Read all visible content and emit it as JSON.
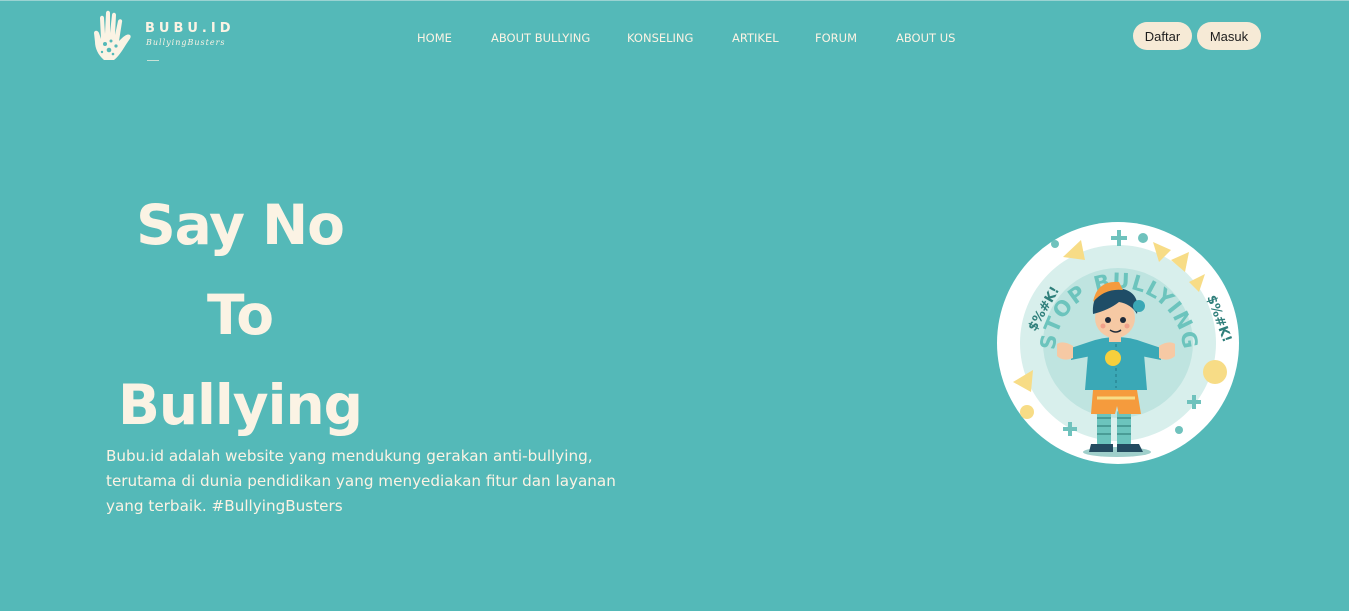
{
  "brand": {
    "name": "BUBU.ID",
    "tagline": "BullyingBusters"
  },
  "nav": {
    "items": [
      {
        "label": "HOME"
      },
      {
        "label": "ABOUT BULLYING"
      },
      {
        "label": "KONSELING"
      },
      {
        "label": "ARTIKEL"
      },
      {
        "label": "FORUM"
      },
      {
        "label": "ABOUT US"
      }
    ]
  },
  "auth": {
    "register_label": "Daftar",
    "login_label": "Masuk"
  },
  "hero": {
    "title_lines": [
      "Say No",
      "To",
      "Bullying"
    ],
    "description": "Bubu.id adalah website yang mendukung gerakan anti-bullying, terutama di dunia pendidikan yang menyediakan fitur dan layanan yang terbaik. #BullyingBusters"
  },
  "illustration": {
    "badge_text": "STOP BULLYING",
    "side_text": "$%#K!"
  },
  "colors": {
    "background": "#54b9b8",
    "cream": "#fbf3e4",
    "button_bg": "#f6ead6",
    "yellow": "#f7dc86",
    "teal_dark": "#2f9b96"
  }
}
